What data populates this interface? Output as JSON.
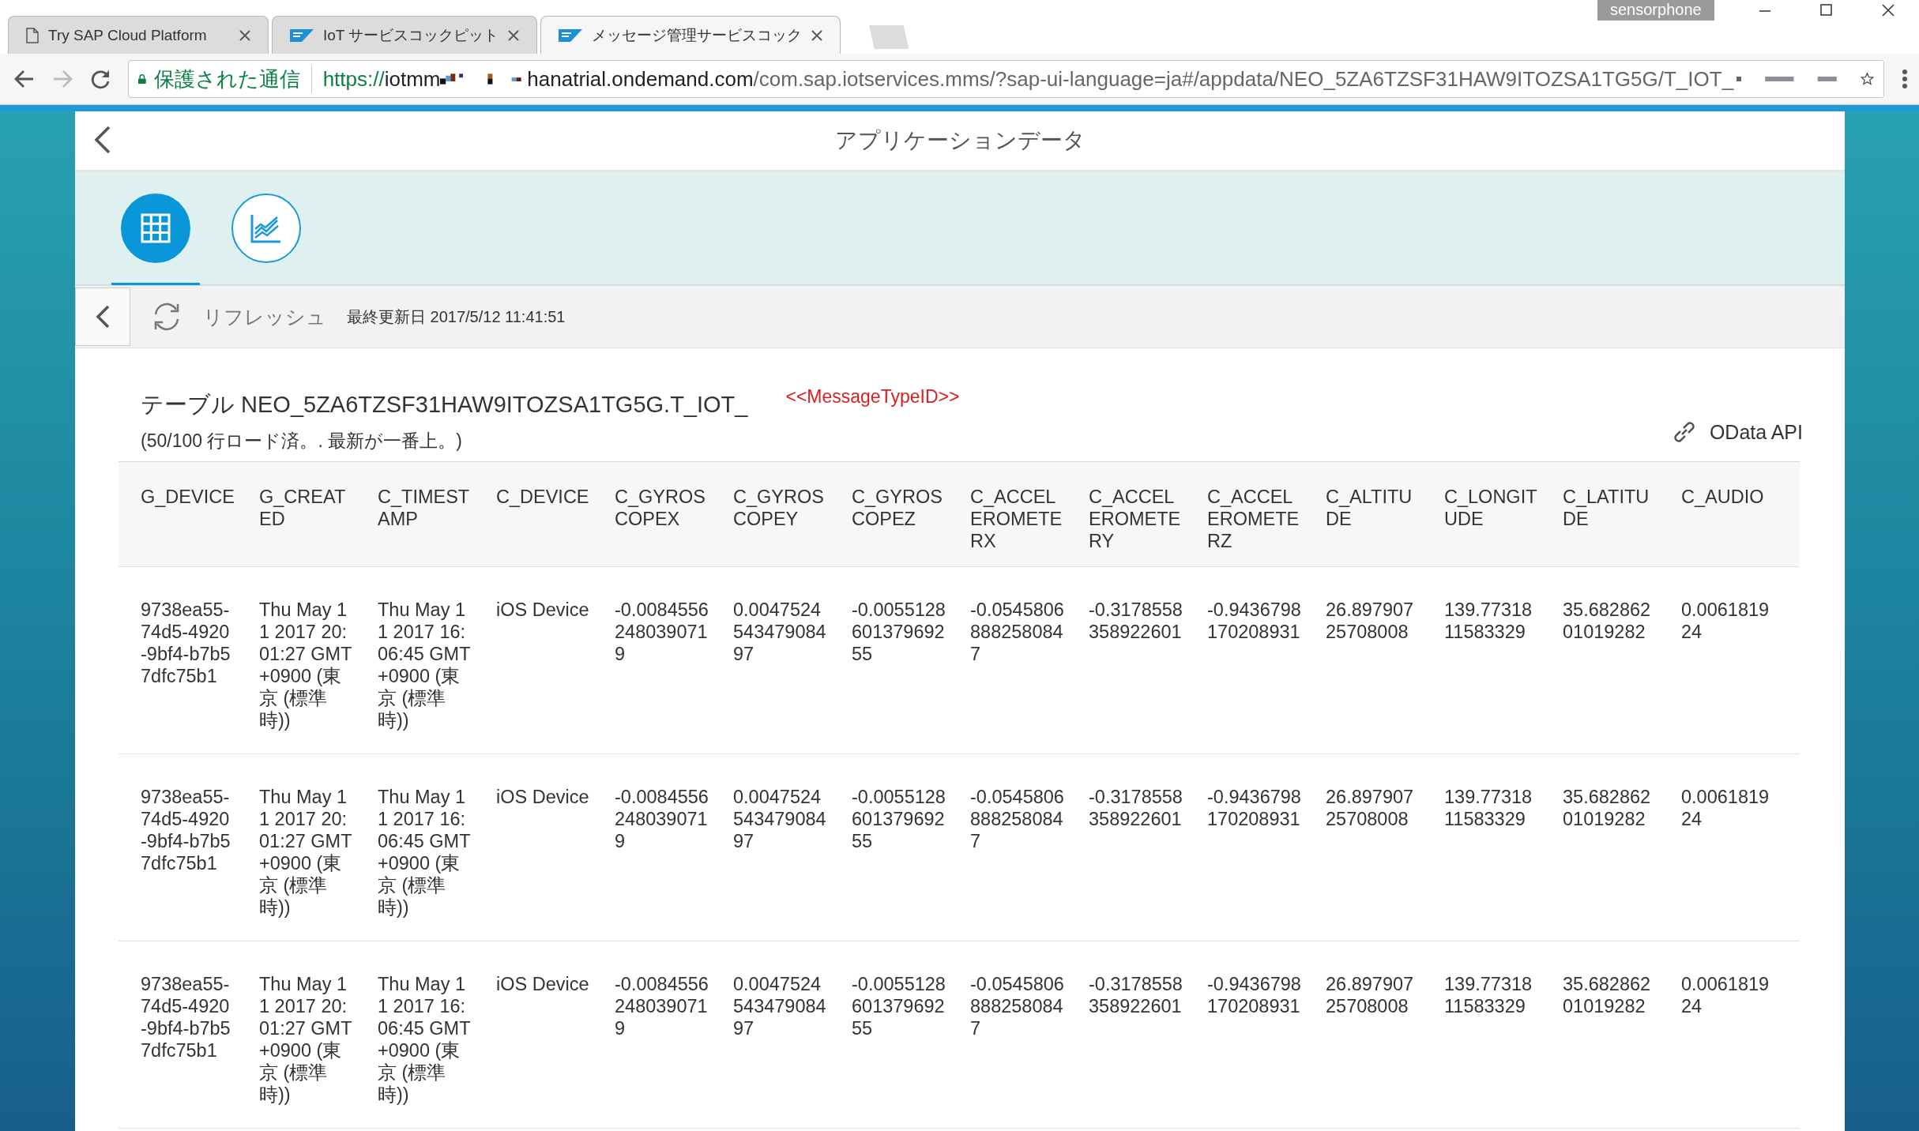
{
  "browser": {
    "tabs": [
      {
        "title": "Try SAP Cloud Platform",
        "kind": "page",
        "selected": false
      },
      {
        "title": "IoT サービスコックピット",
        "kind": "sap",
        "selected": false
      },
      {
        "title": "メッセージ管理サービスコック",
        "kind": "sap",
        "selected": true
      }
    ],
    "profile": "sensorphone",
    "security_label": "保護された通信",
    "url": {
      "scheme": "https://",
      "host_start": "iotmm",
      "host": "hanatrial.ondemand.com",
      "path": "/com.sap.iotservices.mms/?sap-ui-language=ja#/appdata/NEO_5ZA6TZSF31HAW9ITOZSA1TG5G/T_IOT_"
    }
  },
  "page": {
    "title": "アプリケーションデータ",
    "views": [
      {
        "kind": "table",
        "selected": true
      },
      {
        "kind": "chart",
        "selected": false
      }
    ],
    "refresh": "リフレッシュ",
    "last_updated": "最終更新日 2017/5/12 11:41:51",
    "table_title": "テーブル NEO_5ZA6TZSF31HAW9ITOZSA1TG5G.T_IOT_",
    "message_type_note": "<<MessageTypeID>>",
    "rows_note": "(50/100 行ロード済。. 最新が一番上。)",
    "odata_link": "OData API"
  },
  "table": {
    "columns": [
      "G_DEVICE",
      "G_CREATED",
      "C_TIMESTAMP",
      "C_DEVICE",
      "C_GYROSCOPEX",
      "C_GYROSCOPEY",
      "C_GYROSCOPEZ",
      "C_ACCELEROMETERX",
      "C_ACCELEROMETERY",
      "C_ACCELEROMETERZ",
      "C_ALTITUDE",
      "C_LONGITUDE",
      "C_LATITUDE",
      "C_AUDIO"
    ],
    "rows": [
      [
        "9738ea55-74d5-4920-9bf4-b7b57dfc75b1",
        "Thu May 11 2017 20:01:27 GMT+0900 (東京 (標準時))",
        "Thu May 11 2017 16:06:45 GMT+0900 (東京 (標準時))",
        "iOS Device",
        "-0.00845562480390719",
        "0.004752454347908497",
        "-0.005512860137969255",
        "-0.05458068882580847",
        "-0.3178558358922601",
        "-0.9436798170208931",
        "26.89790725708008",
        "139.7731811583329",
        "35.68286201019282",
        "0.006181924"
      ],
      [
        "9738ea55-74d5-4920-9bf4-b7b57dfc75b1",
        "Thu May 11 2017 20:01:27 GMT+0900 (東京 (標準時))",
        "Thu May 11 2017 16:06:45 GMT+0900 (東京 (標準時))",
        "iOS Device",
        "-0.00845562480390719",
        "0.004752454347908497",
        "-0.005512860137969255",
        "-0.05458068882580847",
        "-0.3178558358922601",
        "-0.9436798170208931",
        "26.89790725708008",
        "139.7731811583329",
        "35.68286201019282",
        "0.006181924"
      ],
      [
        "9738ea55-74d5-4920-9bf4-b7b57dfc75b1",
        "Thu May 11 2017 20:01:27 GMT+0900 (東京 (標準時))",
        "Thu May 11 2017 16:06:45 GMT+0900 (東京 (標準時))",
        "iOS Device",
        "-0.00845562480390719",
        "0.004752454347908497",
        "-0.005512860137969255",
        "-0.05458068882580847",
        "-0.3178558358922601",
        "-0.9436798170208931",
        "26.89790725708008",
        "139.7731811583329",
        "35.68286201019282",
        "0.006181924"
      ]
    ]
  }
}
